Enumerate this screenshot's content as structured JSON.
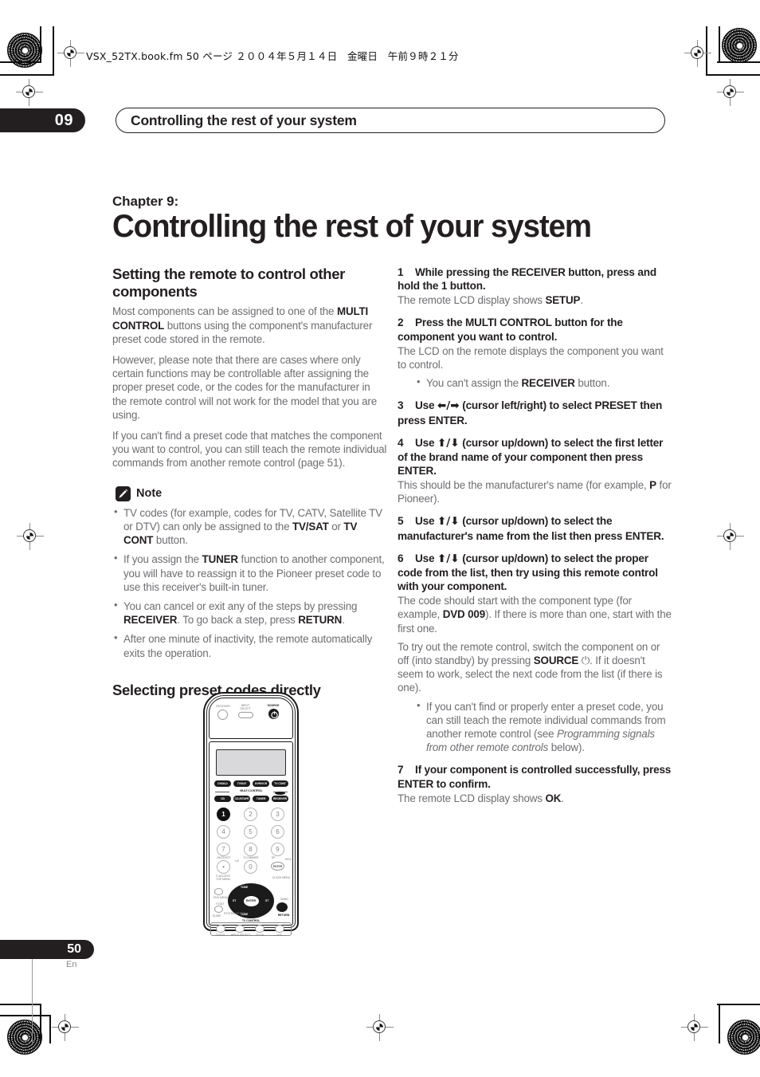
{
  "print": {
    "file_line": "VSX_52TX.book.fm  50 ページ  ２００４年５月１４日　金曜日　午前９時２１分"
  },
  "header": {
    "chapter_number": "09",
    "running_title": "Controlling the rest of your system"
  },
  "title_block": {
    "kicker": "Chapter 9:",
    "title": "Controlling the rest of your system"
  },
  "left_column": {
    "section1_heading": "Setting the remote to control other components",
    "paragraphs": [
      "Most components can be assigned to one of the <b>MULTI CONTROL</b> buttons using the component's manufacturer preset code stored in the remote.",
      "However, please note that there are cases where only certain functions may be controllable after assigning the proper preset code, or the codes for the manufacturer in the remote control will not work for the model that you are using.",
      "If you can't find a preset code that matches the component you want to control, you can still teach the remote individual commands from another remote control (page 51)."
    ],
    "note_label": "Note",
    "note_icon": "pencil-icon",
    "note_bullets": [
      "TV codes (for example, codes for TV, CATV, Satellite TV or DTV) can only be assigned to the <b>TV/SAT</b> or <b>TV CONT</b> button.",
      "If you assign the <b>TUNER</b> function to another component, you will have to reassign it to the Pioneer preset code to use this receiver's built-in tuner.",
      "You can cancel or exit any of the steps by pressing <b>RECEIVER</b>. To go back a step, press <b>RETURN</b>.",
      "After one minute of inactivity, the remote automatically exits the operation."
    ],
    "section2_heading": "Selecting preset codes directly"
  },
  "right_column": {
    "steps": [
      {
        "num": "1",
        "heading": "While pressing the RECEIVER button, press and hold the 1 button.",
        "body": [
          "The remote LCD display shows <b>SETUP</b>."
        ],
        "bullets": []
      },
      {
        "num": "2",
        "heading": "Press the MULTI CONTROL button for the component you want to control.",
        "body": [
          "The LCD on the remote displays the component you want to control."
        ],
        "bullets": [
          "You can't assign the <b>RECEIVER</b> button."
        ]
      },
      {
        "num": "3",
        "heading": "Use <span class=\"arrowset\">➡/➡</span> (cursor left/right) to select PRESET then press ENTER.",
        "body": [],
        "bullets": []
      },
      {
        "num": "4",
        "heading": "Use <span class=\"arrowset\">⬆/⬇</span> (cursor up/down) to select the first letter of the brand name of your component then press ENTER.",
        "body": [
          "This should be the manufacturer's name (for example, <b>P</b> for Pioneer)."
        ],
        "bullets": []
      },
      {
        "num": "5",
        "heading": "Use <span class=\"arrowset\">⬆/⬇</span> (cursor up/down) to select the manufacturer's name from the list then press ENTER.",
        "body": [],
        "bullets": []
      },
      {
        "num": "6",
        "heading": "Use <span class=\"arrowset\">⬆/⬇</span> (cursor up/down) to select the proper code from the list, then try using this remote control with your component.",
        "body": [
          "The code should start with the component type (for example, <b>DVD 009</b>). If there is more than one, start with the first one.",
          "To try out the remote control, switch the component on or off (into standby) by pressing <b>SOURCE</b> ⏻. If it doesn't seem to work, select the next code from the list (if there is one)."
        ],
        "bullets": [
          "If you can't find or properly enter a preset code, you can still teach the remote individual commands from another remote control (see <i>Programming signals from other remote controls</i> below)."
        ]
      },
      {
        "num": "7",
        "heading": "If your component is controlled successfully, press ENTER to confirm.",
        "body": [
          "The remote LCD display shows <b>OK</b>."
        ],
        "bullets": []
      }
    ]
  },
  "remote": {
    "top_labels": {
      "receiver": "RECEIVER",
      "input_select_line1": "INPUT",
      "input_select_line2": "SELECT",
      "source": "SOURCE"
    },
    "multi_control_label": "MULTI CONTROL",
    "component_buttons_row1": [
      "DVD/LD",
      "TV/SAT",
      "DVR/VCR",
      "TV CONT"
    ],
    "component_buttons_row2": [
      "CD",
      "CD-R/TAPE",
      "TUNER",
      "RECEIVER"
    ],
    "numeric_keys": [
      "1",
      "2",
      "3",
      "4",
      "5",
      "6",
      "7",
      "8",
      "9",
      "•",
      "0"
    ],
    "highlighted_key": "1",
    "plus_ten": "+10",
    "sub_labels": {
      "mute": "MUTE/ATT",
      "flomember": "FL DIMMER",
      "sp": "SP",
      "disc": "DISC",
      "enter": "ENTER",
      "class_menu": "CLASS MENU",
      "d_access": "D.ACCESS",
      "top_menu": "TOP MENU",
      "dvd_menu": "DVD MENU",
      "t_edit": "T.EDIT",
      "system_setup": "SYSTEM SETUP",
      "guide": "GUIDE",
      "band": "BAND",
      "return": "RETURN"
    },
    "pad_labels": {
      "up": "TUNE",
      "down": "TUNE",
      "left": "ST",
      "right": "ST",
      "center": "ENTER"
    },
    "tv_control_label": "TV CONTROL",
    "tv_control_buttons": [
      "TV/VOL",
      "INPUT SELECT",
      "TV CH",
      "VOL"
    ]
  },
  "footer": {
    "page_number": "50",
    "language": "En"
  }
}
